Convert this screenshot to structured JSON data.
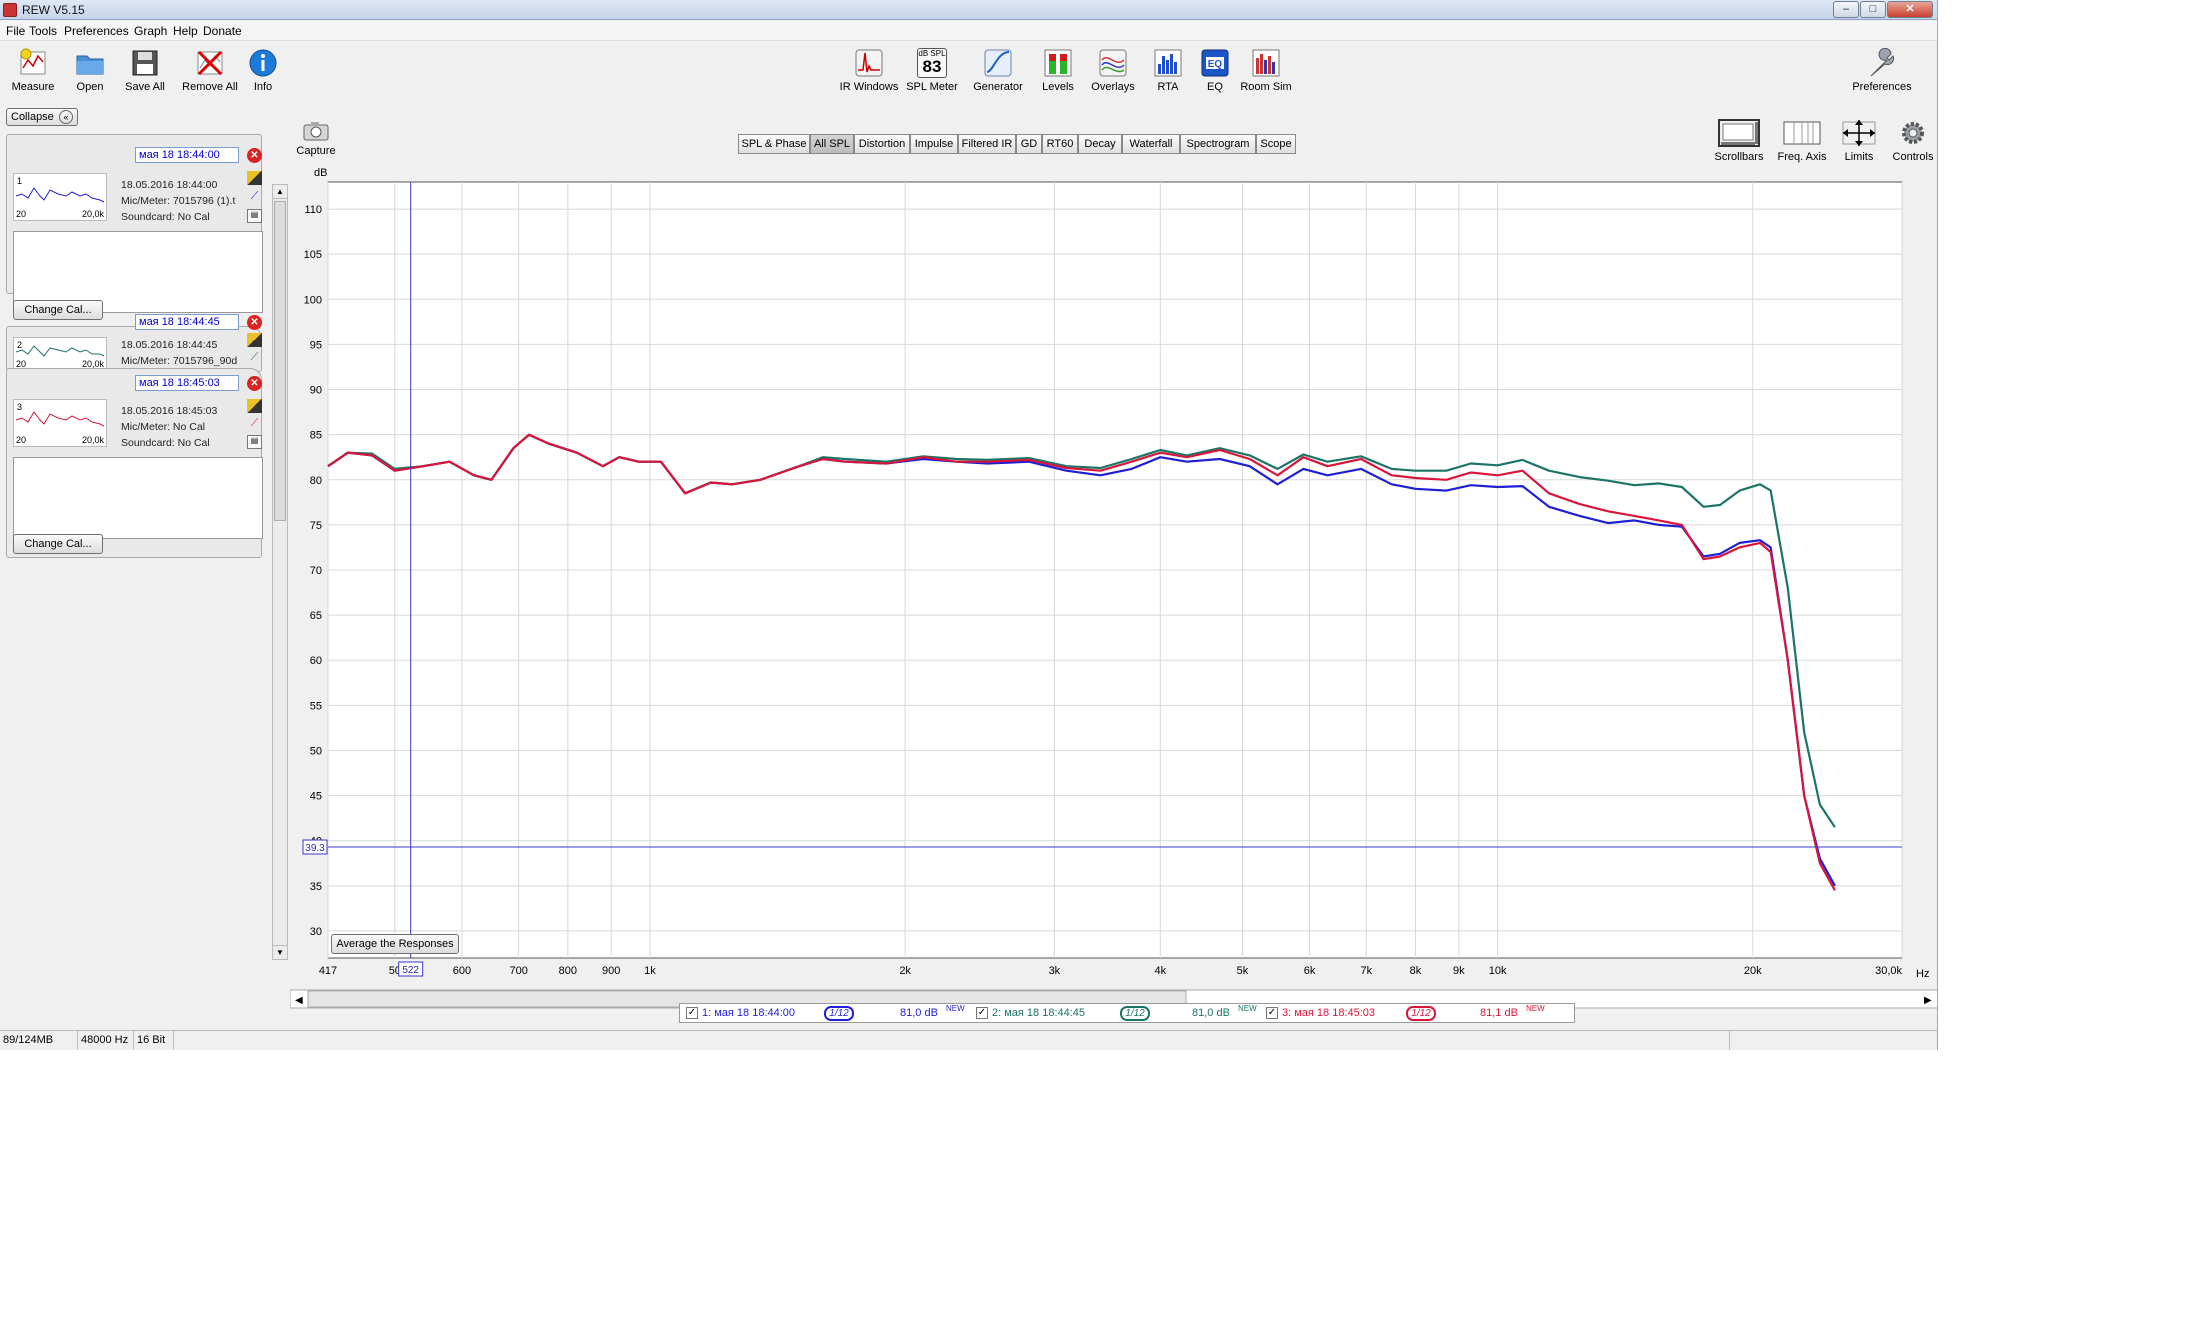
{
  "window": {
    "title": "REW V5.15",
    "min": "–",
    "max": "□",
    "close": "✕"
  },
  "menu": [
    "File",
    "Tools",
    "Preferences",
    "Graph",
    "Help",
    "Donate"
  ],
  "toolbar_left": [
    {
      "label": "Measure",
      "icon": "microphone-icon"
    },
    {
      "label": "Open",
      "icon": "folder-icon"
    },
    {
      "label": "Save All",
      "icon": "floppy-icon"
    },
    {
      "label": "Remove All",
      "icon": "remove-icon"
    },
    {
      "label": "Info",
      "icon": "info-icon"
    }
  ],
  "toolbar_center": [
    {
      "label": "IR Windows",
      "icon": "ir-windows-icon"
    },
    {
      "label": "SPL Meter",
      "icon": "spl-meter-icon",
      "badge_top": "dB SPL",
      "badge_value": "83"
    },
    {
      "label": "Generator",
      "icon": "generator-icon"
    },
    {
      "label": "Levels",
      "icon": "levels-icon"
    },
    {
      "label": "Overlays",
      "icon": "overlays-icon"
    },
    {
      "label": "RTA",
      "icon": "rta-icon"
    },
    {
      "label": "EQ",
      "icon": "eq-icon"
    },
    {
      "label": "Room Sim",
      "icon": "room-sim-icon"
    }
  ],
  "toolbar_right": {
    "label": "Preferences",
    "icon": "wrench-icon"
  },
  "left_panel": {
    "collapse_label": "Collapse",
    "measurements": [
      {
        "index": "1",
        "name": "мая 18 18:44:00",
        "date": "18.05.2016 18:44:00",
        "mic": "Mic/Meter: 7015796 (1).t",
        "soundcard": "Soundcard: No Cal",
        "x_min": "20",
        "x_max": "20,0k",
        "color": "#1f1fd6"
      },
      {
        "index": "2",
        "name": "мая 18 18:44:45",
        "date": "18.05.2016 18:44:45",
        "mic": "Mic/Meter: 7015796_90d",
        "soundcard": "Soundcard: No Cal",
        "x_min": "20",
        "x_max": "20,0k",
        "color": "#1b7468"
      },
      {
        "index": "3",
        "name": "мая 18 18:45:03",
        "date": "18.05.2016 18:45:03",
        "mic": "Mic/Meter: No Cal",
        "soundcard": "Soundcard: No Cal",
        "x_min": "20",
        "x_max": "20,0k",
        "color": "#d8163a"
      }
    ],
    "change_cal": "Change Cal..."
  },
  "graph_controls": {
    "capture": "Capture",
    "tabs": [
      "SPL & Phase",
      "All SPL",
      "Distortion",
      "Impulse",
      "Filtered IR",
      "GD",
      "RT60",
      "Decay",
      "Waterfall",
      "Spectrogram",
      "Scope"
    ],
    "active_tab": "All SPL",
    "right_buttons": [
      {
        "label": "Scrollbars",
        "icon": "scrollbars-icon"
      },
      {
        "label": "Freq. Axis",
        "icon": "freq-axis-icon"
      },
      {
        "label": "Limits",
        "icon": "limits-icon"
      },
      {
        "label": "Controls",
        "icon": "controls-icon"
      }
    ],
    "average_button": "Average the Responses"
  },
  "chart_data": {
    "type": "line",
    "ylabel": "dB",
    "xunit": "Hz",
    "xscale": "log",
    "xlim": [
      417,
      30000
    ],
    "ylim": [
      27,
      113
    ],
    "yticks": [
      30,
      35,
      40,
      45,
      50,
      55,
      60,
      65,
      70,
      75,
      80,
      85,
      90,
      95,
      100,
      105,
      110
    ],
    "xticks": [
      {
        "v": 417,
        "t": "417"
      },
      {
        "v": 500,
        "t": "50"
      },
      {
        "v": 600,
        "t": "600"
      },
      {
        "v": 700,
        "t": "700"
      },
      {
        "v": 800,
        "t": "800"
      },
      {
        "v": 900,
        "t": "900"
      },
      {
        "v": 1000,
        "t": "1k"
      },
      {
        "v": 2000,
        "t": "2k"
      },
      {
        "v": 3000,
        "t": "3k"
      },
      {
        "v": 4000,
        "t": "4k"
      },
      {
        "v": 5000,
        "t": "5k"
      },
      {
        "v": 6000,
        "t": "6k"
      },
      {
        "v": 7000,
        "t": "7k"
      },
      {
        "v": 8000,
        "t": "8k"
      },
      {
        "v": 9000,
        "t": "9k"
      },
      {
        "v": 10000,
        "t": "10k"
      },
      {
        "v": 20000,
        "t": "20k"
      },
      {
        "v": 30000,
        "t": "30,0k"
      }
    ],
    "cursor": {
      "x": 522,
      "y": 39.3,
      "x_label": "522",
      "y_label": "39.3"
    },
    "grid": true,
    "series": [
      {
        "name": "1: мая 18 18:44:00",
        "color": "#1f1fd6",
        "points": [
          [
            417,
            81.5
          ],
          [
            440,
            83
          ],
          [
            470,
            82.7
          ],
          [
            500,
            81
          ],
          [
            540,
            81.5
          ],
          [
            580,
            82
          ],
          [
            620,
            80.5
          ],
          [
            650,
            80
          ],
          [
            690,
            83.5
          ],
          [
            720,
            85
          ],
          [
            760,
            84
          ],
          [
            820,
            83
          ],
          [
            880,
            81.5
          ],
          [
            920,
            82.5
          ],
          [
            970,
            82
          ],
          [
            1030,
            82
          ],
          [
            1100,
            78.5
          ],
          [
            1180,
            79.7
          ],
          [
            1250,
            79.5
          ],
          [
            1350,
            80
          ],
          [
            1500,
            81.5
          ],
          [
            1600,
            82.3
          ],
          [
            1700,
            82
          ],
          [
            1900,
            81.8
          ],
          [
            2100,
            82.3
          ],
          [
            2300,
            82
          ],
          [
            2500,
            81.8
          ],
          [
            2800,
            82
          ],
          [
            3100,
            81
          ],
          [
            3400,
            80.5
          ],
          [
            3700,
            81.2
          ],
          [
            4000,
            82.5
          ],
          [
            4300,
            82
          ],
          [
            4700,
            82.3
          ],
          [
            5100,
            81.5
          ],
          [
            5500,
            79.5
          ],
          [
            5900,
            81.2
          ],
          [
            6300,
            80.5
          ],
          [
            6900,
            81.2
          ],
          [
            7500,
            79.5
          ],
          [
            8000,
            79
          ],
          [
            8700,
            78.8
          ],
          [
            9300,
            79.4
          ],
          [
            10000,
            79.2
          ],
          [
            10700,
            79.3
          ],
          [
            11500,
            77
          ],
          [
            12500,
            76
          ],
          [
            13500,
            75.2
          ],
          [
            14500,
            75.5
          ],
          [
            15500,
            75
          ],
          [
            16500,
            74.8
          ],
          [
            17500,
            71.5
          ],
          [
            18300,
            71.8
          ],
          [
            19300,
            73
          ],
          [
            20400,
            73.3
          ],
          [
            21000,
            72.5
          ],
          [
            22000,
            60
          ],
          [
            23000,
            45
          ],
          [
            24000,
            38
          ],
          [
            25000,
            35
          ]
        ]
      },
      {
        "name": "2: мая 18 18:44:45",
        "color": "#1b7468",
        "points": [
          [
            417,
            81.5
          ],
          [
            440,
            83
          ],
          [
            470,
            82.9
          ],
          [
            500,
            81.2
          ],
          [
            540,
            81.5
          ],
          [
            580,
            82
          ],
          [
            620,
            80.5
          ],
          [
            650,
            80
          ],
          [
            690,
            83.5
          ],
          [
            720,
            85
          ],
          [
            760,
            84
          ],
          [
            820,
            83
          ],
          [
            880,
            81.5
          ],
          [
            920,
            82.5
          ],
          [
            970,
            82
          ],
          [
            1030,
            82
          ],
          [
            1100,
            78.5
          ],
          [
            1180,
            79.7
          ],
          [
            1250,
            79.5
          ],
          [
            1350,
            80
          ],
          [
            1500,
            81.5
          ],
          [
            1600,
            82.5
          ],
          [
            1700,
            82.3
          ],
          [
            1900,
            82
          ],
          [
            2100,
            82.6
          ],
          [
            2300,
            82.3
          ],
          [
            2500,
            82.2
          ],
          [
            2800,
            82.4
          ],
          [
            3100,
            81.5
          ],
          [
            3400,
            81.3
          ],
          [
            3700,
            82.3
          ],
          [
            4000,
            83.3
          ],
          [
            4300,
            82.7
          ],
          [
            4700,
            83.5
          ],
          [
            5100,
            82.7
          ],
          [
            5500,
            81.2
          ],
          [
            5900,
            82.8
          ],
          [
            6300,
            82
          ],
          [
            6900,
            82.6
          ],
          [
            7500,
            81.2
          ],
          [
            8000,
            81
          ],
          [
            8700,
            81
          ],
          [
            9300,
            81.8
          ],
          [
            10000,
            81.6
          ],
          [
            10700,
            82.2
          ],
          [
            11500,
            81
          ],
          [
            12500,
            80.3
          ],
          [
            13500,
            79.9
          ],
          [
            14500,
            79.4
          ],
          [
            15500,
            79.6
          ],
          [
            16500,
            79.2
          ],
          [
            17500,
            77
          ],
          [
            18300,
            77.2
          ],
          [
            19300,
            78.8
          ],
          [
            20400,
            79.5
          ],
          [
            21000,
            78.8
          ],
          [
            22000,
            68
          ],
          [
            23000,
            52
          ],
          [
            24000,
            44
          ],
          [
            25000,
            41.5
          ]
        ]
      },
      {
        "name": "3: мая 18 18:45:03",
        "color": "#d8163a",
        "points": [
          [
            417,
            81.5
          ],
          [
            440,
            83
          ],
          [
            470,
            82.7
          ],
          [
            500,
            81
          ],
          [
            540,
            81.5
          ],
          [
            580,
            82
          ],
          [
            620,
            80.5
          ],
          [
            650,
            80
          ],
          [
            690,
            83.5
          ],
          [
            720,
            85
          ],
          [
            760,
            84
          ],
          [
            820,
            83
          ],
          [
            880,
            81.5
          ],
          [
            920,
            82.5
          ],
          [
            970,
            82
          ],
          [
            1030,
            82
          ],
          [
            1100,
            78.5
          ],
          [
            1180,
            79.7
          ],
          [
            1250,
            79.5
          ],
          [
            1350,
            80
          ],
          [
            1500,
            81.5
          ],
          [
            1600,
            82.3
          ],
          [
            1700,
            82
          ],
          [
            1900,
            81.8
          ],
          [
            2100,
            82.5
          ],
          [
            2300,
            82
          ],
          [
            2500,
            82
          ],
          [
            2800,
            82.2
          ],
          [
            3100,
            81.3
          ],
          [
            3400,
            81
          ],
          [
            3700,
            82
          ],
          [
            4000,
            83
          ],
          [
            4300,
            82.5
          ],
          [
            4700,
            83.3
          ],
          [
            5100,
            82.3
          ],
          [
            5500,
            80.5
          ],
          [
            5900,
            82.5
          ],
          [
            6300,
            81.5
          ],
          [
            6900,
            82.3
          ],
          [
            7500,
            80.5
          ],
          [
            8000,
            80.2
          ],
          [
            8700,
            80
          ],
          [
            9300,
            80.8
          ],
          [
            10000,
            80.5
          ],
          [
            10700,
            81
          ],
          [
            11500,
            78.5
          ],
          [
            12500,
            77.3
          ],
          [
            13500,
            76.5
          ],
          [
            14500,
            76
          ],
          [
            15500,
            75.5
          ],
          [
            16500,
            75
          ],
          [
            17500,
            71.2
          ],
          [
            18300,
            71.5
          ],
          [
            19300,
            72.5
          ],
          [
            20400,
            73
          ],
          [
            21000,
            72
          ],
          [
            22000,
            60
          ],
          [
            23000,
            45
          ],
          [
            24000,
            37.5
          ],
          [
            25000,
            34.5
          ]
        ]
      }
    ],
    "legend": [
      {
        "label": "1: мая 18 18:44:00",
        "smoothing": "1/12",
        "value": "81,0 dB",
        "tag": "NEW",
        "color": "#1f1fd6"
      },
      {
        "label": "2: мая 18 18:44:45",
        "smoothing": "1/12",
        "value": "81,0 dB",
        "tag": "NEW",
        "color": "#1b7468"
      },
      {
        "label": "3: мая 18 18:45:03",
        "smoothing": "1/12",
        "value": "81,1 dB",
        "tag": "NEW",
        "color": "#d8163a"
      }
    ]
  },
  "status": {
    "memory": "89/124MB",
    "rate": "48000 Hz",
    "bits": "16 Bit"
  }
}
